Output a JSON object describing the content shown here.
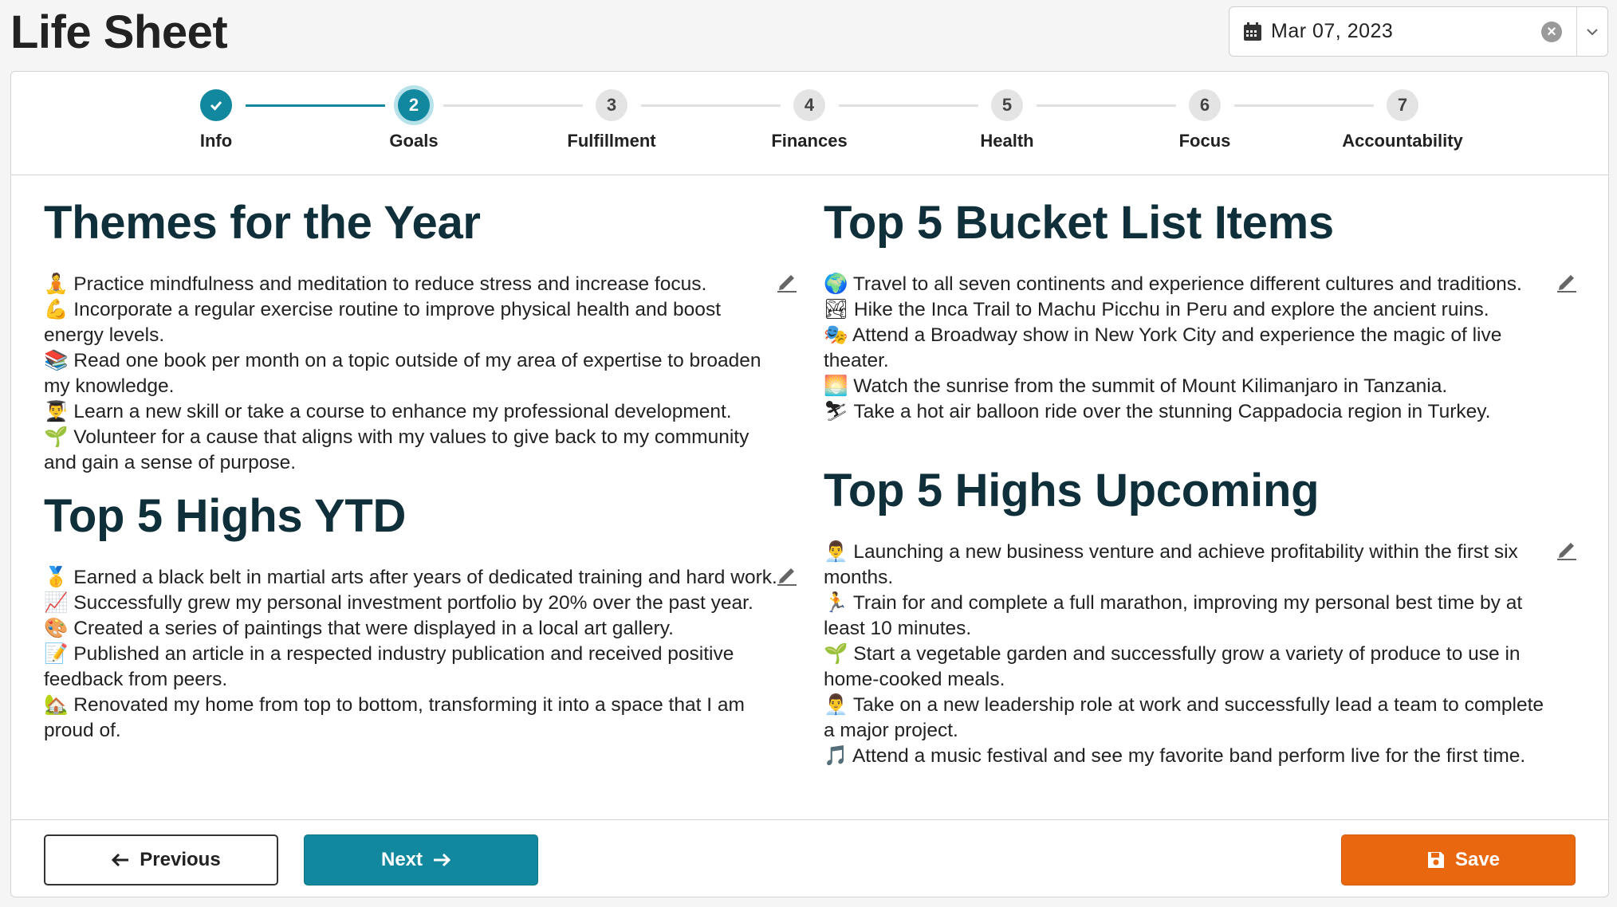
{
  "page": {
    "title": "Life Sheet"
  },
  "date_picker": {
    "value": "Mar 07, 2023",
    "clear_icon": "clear-circle-icon",
    "calendar_icon": "calendar-icon",
    "dropdown_icon": "chevron-down-icon"
  },
  "colors": {
    "accent": "#12889e",
    "save": "#e8670f",
    "heading": "#0f2f3a"
  },
  "stepper": {
    "steps": [
      {
        "number": "1",
        "label": "Info",
        "state": "done"
      },
      {
        "number": "2",
        "label": "Goals",
        "state": "active"
      },
      {
        "number": "3",
        "label": "Fulfillment",
        "state": "pending"
      },
      {
        "number": "4",
        "label": "Finances",
        "state": "pending"
      },
      {
        "number": "5",
        "label": "Health",
        "state": "pending"
      },
      {
        "number": "6",
        "label": "Focus",
        "state": "pending"
      },
      {
        "number": "7",
        "label": "Accountability",
        "state": "pending"
      }
    ]
  },
  "sections": {
    "themes": {
      "title": "Themes for the Year",
      "items": [
        "🧘 Practice mindfulness and meditation to reduce stress and increase focus.",
        "💪 Incorporate a regular exercise routine to improve physical health and boost energy levels.",
        "📚 Read one book per month on a topic outside of my area of expertise to broaden my knowledge.",
        "👨‍🎓 Learn a new skill or take a course to enhance my professional development.",
        "🌱 Volunteer for a cause that aligns with my values to give back to my community and gain a sense of purpose."
      ]
    },
    "highs_ytd": {
      "title": "Top 5 Highs YTD",
      "items": [
        "🥇 Earned a black belt in martial arts after years of dedicated training and hard work.",
        "📈 Successfully grew my personal investment portfolio by 20% over the past year.",
        "🎨 Created a series of paintings that were displayed in a local art gallery.",
        "📝 Published an article in a respected industry publication and received positive feedback from peers.",
        "🏡 Renovated my home from top to bottom, transforming it into a space that I am proud of."
      ]
    },
    "bucket_list": {
      "title": "Top 5 Bucket List Items",
      "items": [
        "🌍 Travel to all seven continents and experience different cultures and traditions.",
        "🏞 Hike the Inca Trail to Machu Picchu in Peru and explore the ancient ruins.",
        "🎭 Attend a Broadway show in New York City and experience the magic of live theater.",
        "🌅 Watch the sunrise from the summit of Mount Kilimanjaro in Tanzania.",
        "⛷ Take a hot air balloon ride over the stunning Cappadocia region in Turkey."
      ]
    },
    "highs_upcoming": {
      "title": "Top 5 Highs Upcoming",
      "items": [
        "👨‍💼 Launching a new business venture and achieve profitability within the first six months.",
        "🏃 Train for and complete a full marathon, improving my personal best time by at least 10 minutes.",
        "🌱 Start a vegetable garden and successfully grow a variety of produce to use in home-cooked meals.",
        "👨‍💼 Take on a new leadership role at work and successfully lead a team to complete a major project.",
        "🎵 Attend a music festival and see my favorite band perform live for the first time."
      ]
    }
  },
  "footer": {
    "previous_label": "Previous",
    "next_label": "Next",
    "save_label": "Save"
  }
}
